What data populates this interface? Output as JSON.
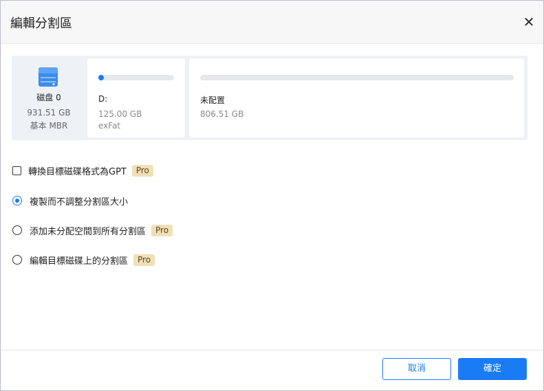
{
  "dialog": {
    "title": "編輯分割區",
    "close_icon": "close-icon"
  },
  "disk": {
    "icon": "disk-icon",
    "name": "磁盘 0",
    "size": "931.51 GB",
    "type": "基本 MBR",
    "colors": {
      "accent": "#1a7cf5",
      "track": "#e6e8ec",
      "panel": "#eef1f5"
    }
  },
  "partitions": [
    {
      "label": "D:",
      "size": "125.00 GB",
      "filesystem": "exFat",
      "used_fraction": 0.07
    },
    {
      "label": "未配置",
      "size": "806.51 GB",
      "filesystem": "",
      "used_fraction": 0
    }
  ],
  "options": {
    "convert_gpt": {
      "label": "轉換目標磁碟格式為GPT",
      "badge": "Pro",
      "checked": false
    },
    "copy_no_resize": {
      "label": "複製而不調整分割區大小",
      "selected": true
    },
    "add_unallocated": {
      "label": "添加未分配空間到所有分割區",
      "badge": "Pro",
      "selected": false
    },
    "edit_partitions": {
      "label": "編輯目標磁碟上的分割區",
      "badge": "Pro",
      "selected": false
    }
  },
  "footer": {
    "cancel_label": "取消",
    "ok_label": "確定"
  }
}
